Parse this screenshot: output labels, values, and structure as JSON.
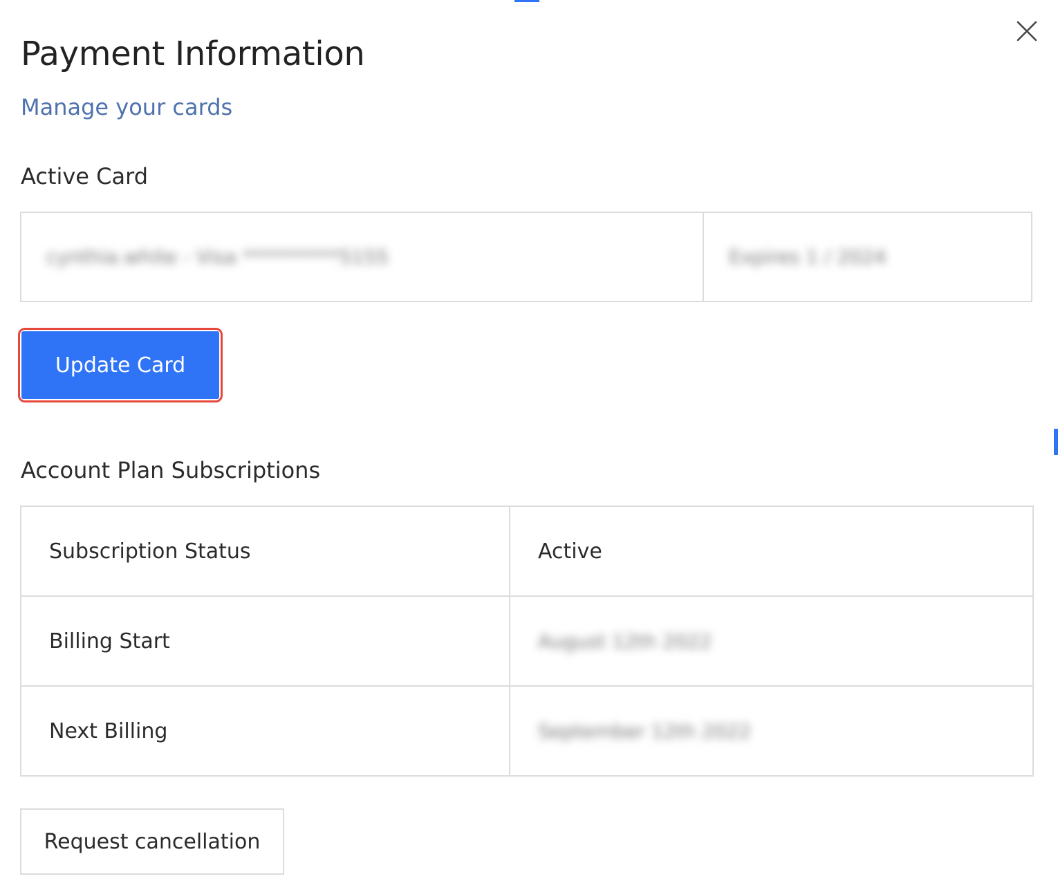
{
  "modal": {
    "title": "Payment Information",
    "manage_link": "Manage your cards",
    "close_icon": "close-icon"
  },
  "active_card": {
    "heading": "Active Card",
    "card_label_redacted": "cynthia.white - Visa **********5155",
    "expiry_redacted": "Expires 1 / 2024",
    "update_button": "Update Card"
  },
  "subscriptions": {
    "heading": "Account Plan Subscriptions",
    "rows": [
      {
        "label": "Subscription Status",
        "value": "Active",
        "redacted": false
      },
      {
        "label": "Billing Start",
        "value": "August 12th 2022",
        "redacted": true
      },
      {
        "label": "Next Billing",
        "value": "September 12th 2022",
        "redacted": true
      }
    ],
    "cancel_button": "Request cancellation"
  },
  "colors": {
    "primary": "#2f74f6",
    "link": "#4f72ad",
    "highlight_ring": "#e5483b",
    "border": "#dcdcdc"
  }
}
